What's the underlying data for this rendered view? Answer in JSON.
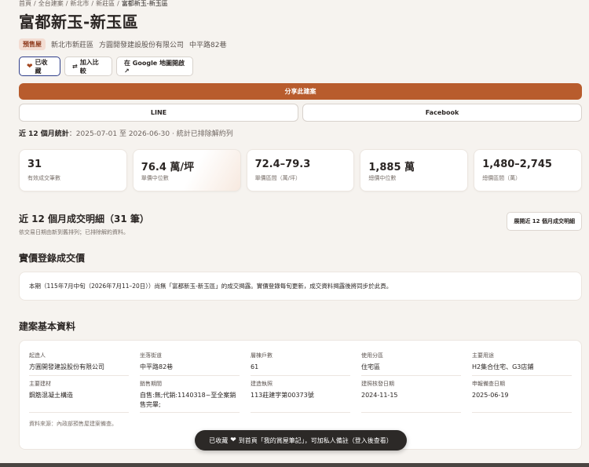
{
  "breadcrumb": [
    "首頁",
    "全台建案",
    "新北市",
    "新莊區",
    "富都新玉-新玉區"
  ],
  "breadcrumb_sep": "/",
  "title": "富都新玉-新玉區",
  "meta": {
    "badge": "預售屋",
    "district": "新北市新莊區",
    "developer": "方圓開發建設股份有限公司",
    "address": "中平路82巷"
  },
  "actions": {
    "favorite": "已收藏",
    "compare": "加入比較",
    "map": "在 Google 地圖開啟 ↗"
  },
  "share": {
    "label": "分享此建案",
    "line": "LINE",
    "facebook": "Facebook"
  },
  "stats": {
    "prefix": "近 12 個月統計",
    "range": "：2025-07-01 至 2026-06-30",
    "sep": "·",
    "note": "統計已排除解約列"
  },
  "cards": [
    {
      "value": "31",
      "label": "有效成交筆數"
    },
    {
      "value": "76.4 萬/坪",
      "label": "單價中位數"
    },
    {
      "value": "72.4–79.3",
      "label": "單價區間（萬/坪）"
    },
    {
      "value": "1,885 萬",
      "label": "總價中位數"
    },
    {
      "value": "1,480–2,745",
      "label": "總價區間（萬）"
    }
  ],
  "details": {
    "title": "近 12 個月成交明細（31 筆）",
    "subtitle": "依交易日期由新到舊排列；已排除解約資料。",
    "expand": "展開近 12 個月成交明細"
  },
  "realprice": {
    "title": "實價登錄成交價",
    "notice": "本期（115年7月中旬（2026年7月11–20日））尚無「富都新玉-新玉區」的成交揭露。實價登錄每旬更新，成交資料揭露後將同步於此頁。"
  },
  "basic": {
    "title": "建案基本資料",
    "rows": [
      [
        {
          "k": "起造人",
          "v": "方圓開發建設股份有限公司"
        },
        {
          "k": "坐落街道",
          "v": "中平路82巷"
        },
        {
          "k": "層棟戶數",
          "v": "61"
        },
        {
          "k": "使用分區",
          "v": "住宅區"
        },
        {
          "k": "主要用途",
          "v": "H2集合住宅、G3店鋪"
        }
      ],
      [
        {
          "k": "主要建材",
          "v": "鋼筋混凝土構造"
        },
        {
          "k": "銷售期間",
          "v": "自售:無;代銷:1140318~至全案銷售完畢;"
        },
        {
          "k": "建造執照",
          "v": "113莊建字第00373號"
        },
        {
          "k": "建照核發日期",
          "v": "2024-11-15"
        },
        {
          "k": "申報備查日期",
          "v": "2025-06-19"
        }
      ]
    ],
    "source": "資料來源：內政部預售屋建案備查。"
  },
  "toast": {
    "pre": "已收藏",
    "post": "到首頁「我的賞屋筆記」，可加私人備註（登入後查看）"
  }
}
